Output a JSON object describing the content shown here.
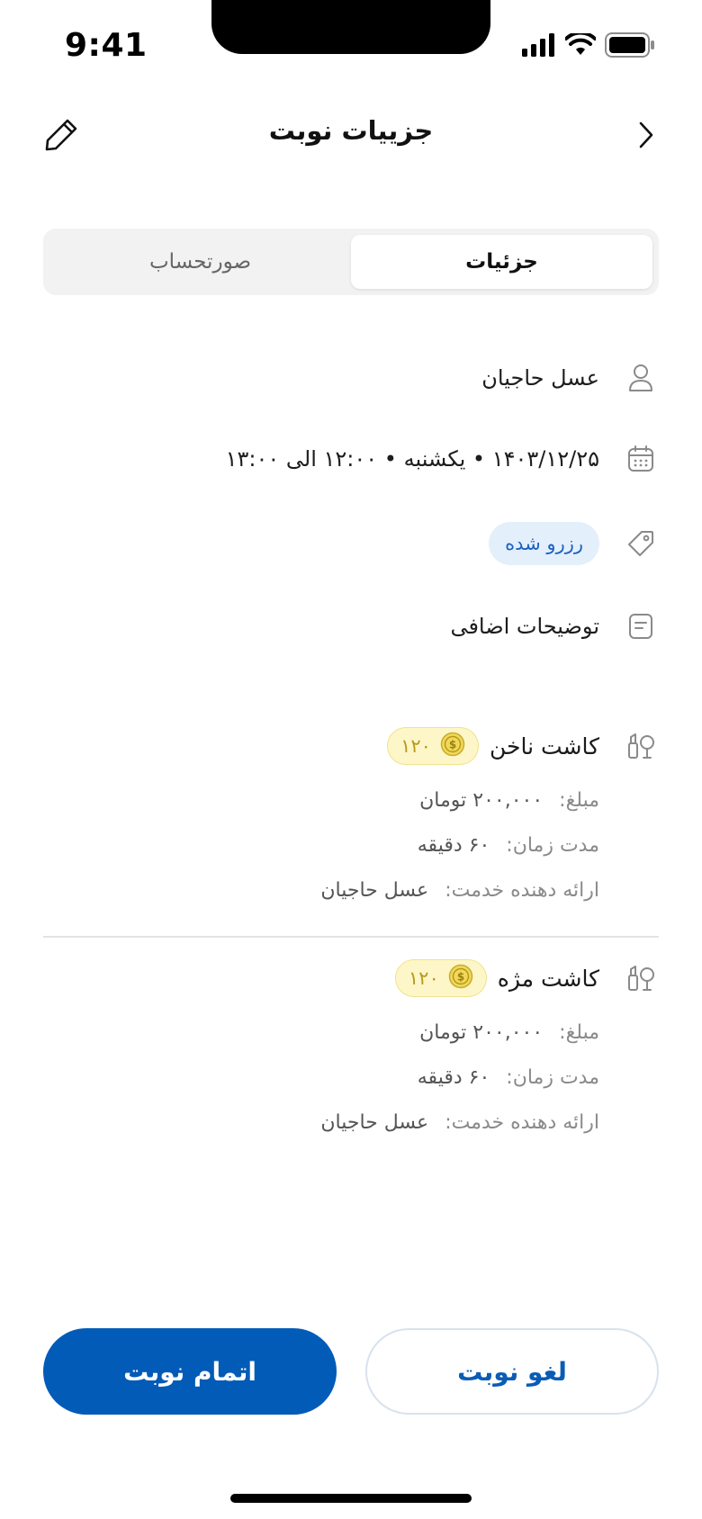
{
  "status_bar": {
    "time": "9:41"
  },
  "header": {
    "title": "جزییات نوبت"
  },
  "tabs": [
    {
      "label": "جزئیات",
      "active": true
    },
    {
      "label": "صورتحساب",
      "active": false
    }
  ],
  "info": {
    "customer": "عسل حاجیان",
    "datetime": "۱۴۰۳/۱۲/۲۵ • یکشنبه • ۱۲:۰۰ الی ۱۳:۰۰",
    "status": "رزرو شده",
    "notes": "توضیحات اضافی"
  },
  "services": [
    {
      "name": "کاشت ناخن",
      "coins": "۱۲۰",
      "price_label": "مبلغ:",
      "price": "۲۰۰,۰۰۰ تومان",
      "duration_label": "مدت زمان:",
      "duration": "۶۰ دقیقه",
      "provider_label": "ارائه دهنده خدمت:",
      "provider": "عسل حاجیان"
    },
    {
      "name": "کاشت مژه",
      "coins": "۱۲۰",
      "price_label": "مبلغ:",
      "price": "۲۰۰,۰۰۰ تومان",
      "duration_label": "مدت زمان:",
      "duration": "۶۰ دقیقه",
      "provider_label": "ارائه دهنده خدمت:",
      "provider": "عسل حاجیان"
    }
  ],
  "actions": {
    "complete": "اتمام نوبت",
    "cancel": "لغو نوبت"
  },
  "colors": {
    "primary": "#035bb8",
    "badge_bg": "#e3effb",
    "coin_bg": "#fdf6c8",
    "coin_text": "#b89a1a"
  },
  "icons": {
    "back": "chevron-right-icon",
    "edit": "pencil-icon",
    "customer": "user-icon",
    "date": "calendar-icon",
    "status": "tag-icon",
    "notes": "note-icon",
    "service": "beauty-icon",
    "coin": "coin-icon"
  }
}
